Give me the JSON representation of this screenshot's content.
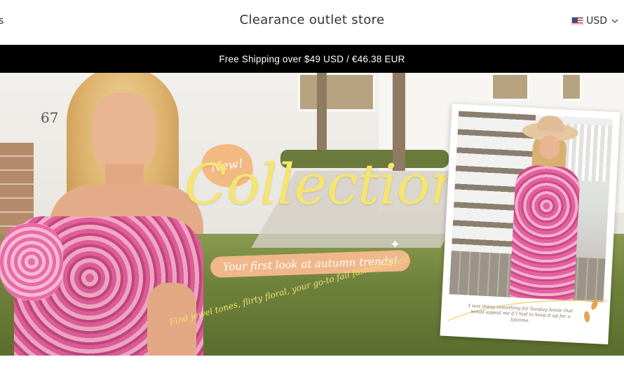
{
  "header": {
    "left_fragment": "s",
    "store_title": "Clearance outlet store",
    "currency": {
      "code": "USD",
      "flag_icon": "us-flag-icon",
      "chevron_icon": "chevron-down-icon"
    }
  },
  "announcement": {
    "text": "Free Shipping over $49 USD / €46.38 EUR"
  },
  "hero": {
    "badge": "New!",
    "headline": "Collection",
    "tagline": "Your first look at autumn trends!",
    "subline": "Find jewel tones, flirty floral, your go-to fall fashion faves!",
    "house_number": "67",
    "polaroid_caption": "I was doing something for Sunday Annie that would appeal me if I had to keep it up for a lifetime."
  },
  "colors": {
    "announce_bg": "#000000",
    "headline": "#f5e46f",
    "badge": "#f2b983",
    "tagline_bg": "#f0b78a"
  }
}
